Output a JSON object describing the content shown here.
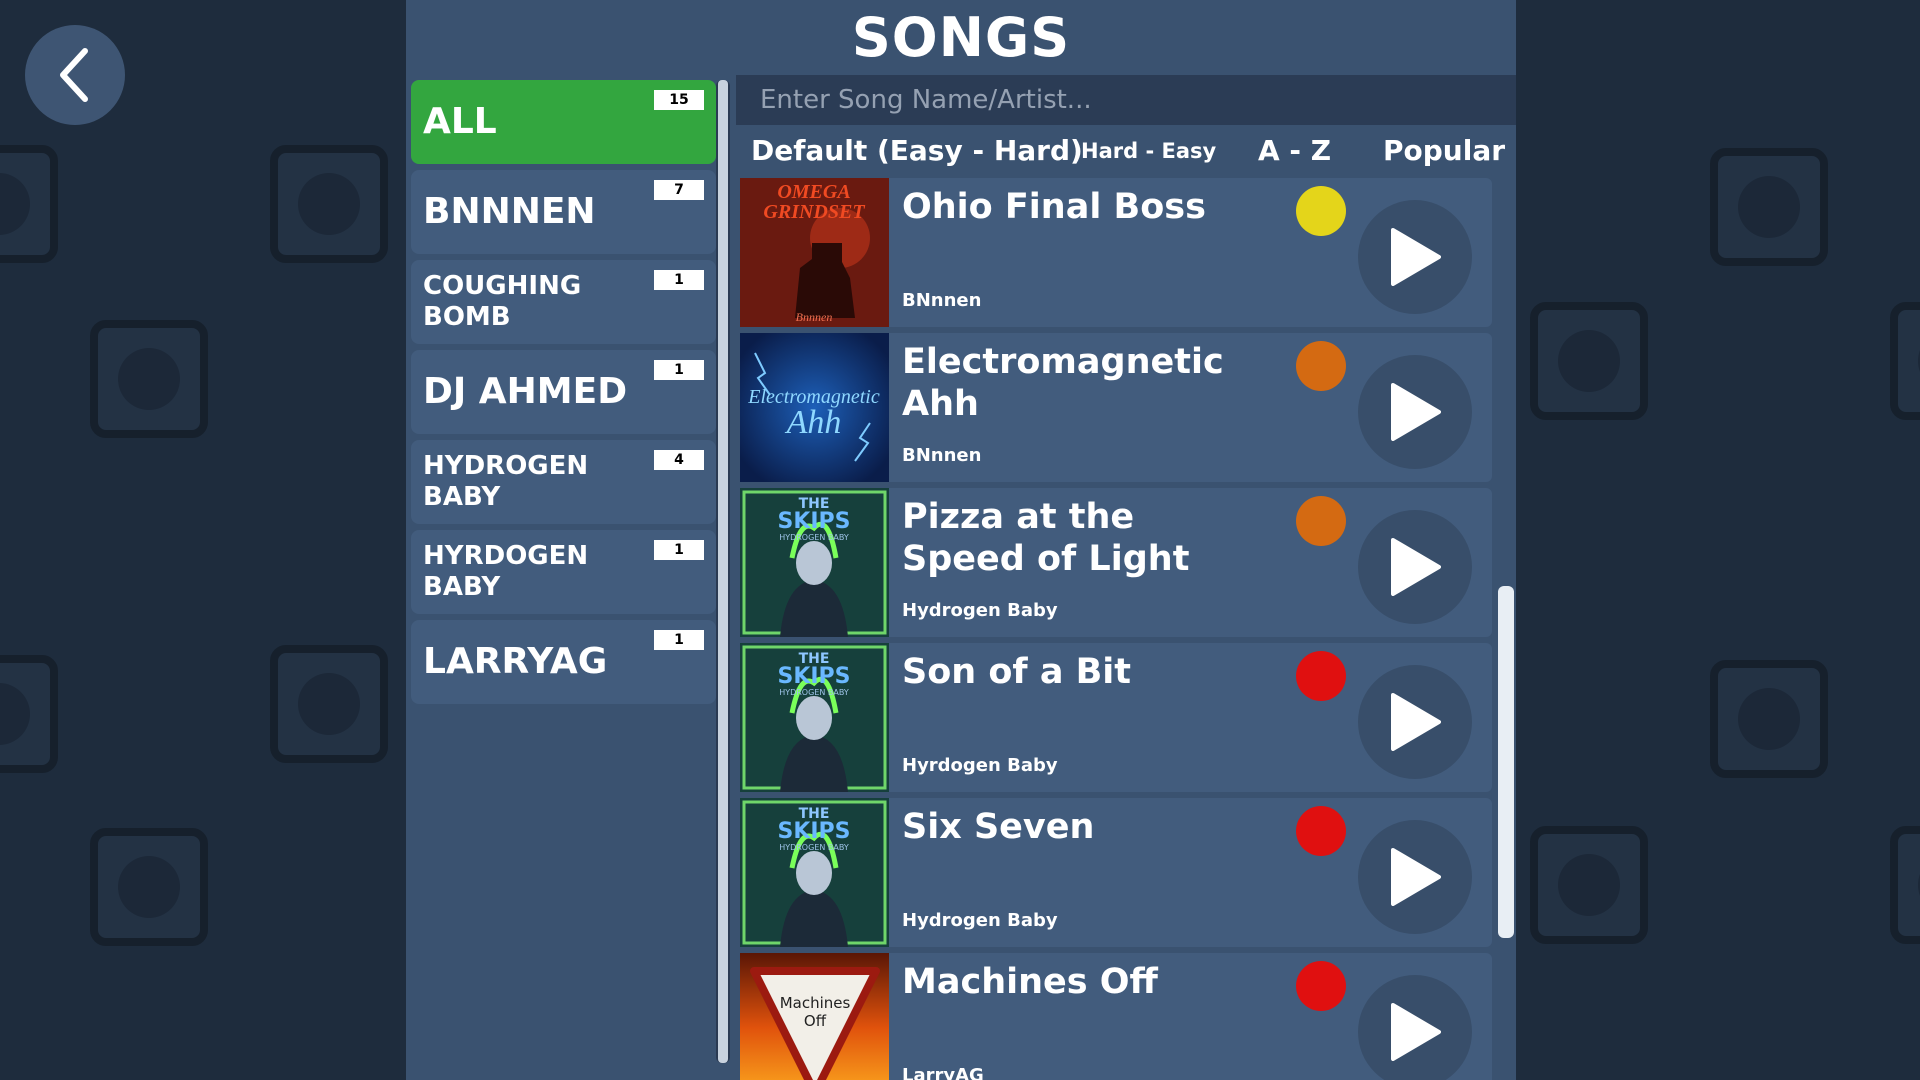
{
  "header": {
    "title": "SONGS",
    "back_icon": "chevron-left-icon"
  },
  "categories": [
    {
      "label": "ALL",
      "count": "15",
      "active": true
    },
    {
      "label": "BNNNEN",
      "count": "7"
    },
    {
      "label": "COUGHING BOMB",
      "count": "1"
    },
    {
      "label": "DJ AHMED",
      "count": "1"
    },
    {
      "label": "HYDROGEN BABY",
      "count": "4"
    },
    {
      "label": "HYRDOGEN BABY",
      "count": "1"
    },
    {
      "label": "LARRYAG",
      "count": "1"
    }
  ],
  "search": {
    "placeholder": "Enter Song Name/Artist..."
  },
  "sort": {
    "default": "Default (Easy - Hard)",
    "hard_easy": "Hard - Easy",
    "az": "A - Z",
    "popular": "Popular"
  },
  "songs": [
    {
      "name": "Ohio Final Boss",
      "artist": "BNnnen",
      "difficulty_color": "#e4d51a",
      "art_text": [
        "OMEGA",
        "GRINDSET",
        "Bnnnen"
      ]
    },
    {
      "name": "Electromagnetic Ahh",
      "artist": "BNnnen",
      "difficulty_color": "#d46a12",
      "art_text": [
        "Electromagnetic",
        "Ahh"
      ]
    },
    {
      "name": "Pizza at the Speed of Light",
      "artist": "Hydrogen Baby",
      "difficulty_color": "#d46a12",
      "art_text": [
        "THE",
        "SKIPS",
        "HYDROGEN BABY"
      ]
    },
    {
      "name": "Son of a Bit",
      "artist": "Hyrdogen Baby",
      "difficulty_color": "#e01010",
      "art_text": [
        "THE",
        "SKIPS",
        "HYDROGEN BABY"
      ]
    },
    {
      "name": "Six Seven",
      "artist": "Hydrogen Baby",
      "difficulty_color": "#e01010",
      "art_text": [
        "THE",
        "SKIPS",
        "HYDROGEN BABY"
      ]
    },
    {
      "name": "Machines Off",
      "artist": "LarryAG",
      "difficulty_color": "#e01010",
      "art_text": [
        "Machines",
        "Off"
      ]
    }
  ],
  "colors": {
    "accent_green": "#33a63f",
    "panel": "#3a5270",
    "row": "#425c7d"
  }
}
